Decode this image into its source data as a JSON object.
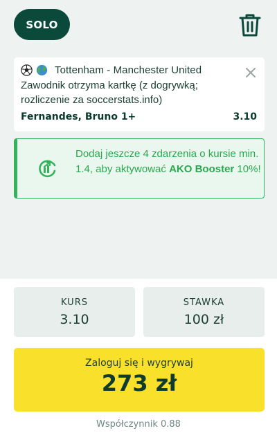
{
  "topbar": {
    "solo_label": "SOLO",
    "icons": {
      "trash": "trash-icon"
    }
  },
  "bet": {
    "match": "Tottenham - Manchester United",
    "market": "Zawodnik otrzyma kartkę (z dogrywką; rozliczenie za soccerstats.info)",
    "selection": "Fernandes, Bruno 1+",
    "odds": "3.10",
    "icons": [
      "soccer-ball-icon",
      "globe-icon",
      "close-icon"
    ]
  },
  "ako": {
    "text_prefix": "Dodaj jeszcze 4 zdarzenia o kursie min. 1.4, aby aktywować ",
    "text_bold": "AKO Booster",
    "text_suffix": " 10%!",
    "icon": "ako-booster-icon",
    "accent": "#35b25c"
  },
  "summary": {
    "kurs_label": "KURS",
    "kurs_value": "3.10",
    "stawka_label": "STAWKA",
    "stawka_value": "100 zł",
    "login_label": "Zaloguj się i wygrywaj",
    "win_amount": "273 zł",
    "coefficient": "Współczynnik 0.88"
  },
  "colors": {
    "primary": "#0b4a3a",
    "cta": "#f9e12b",
    "background": "#eef3f1"
  }
}
